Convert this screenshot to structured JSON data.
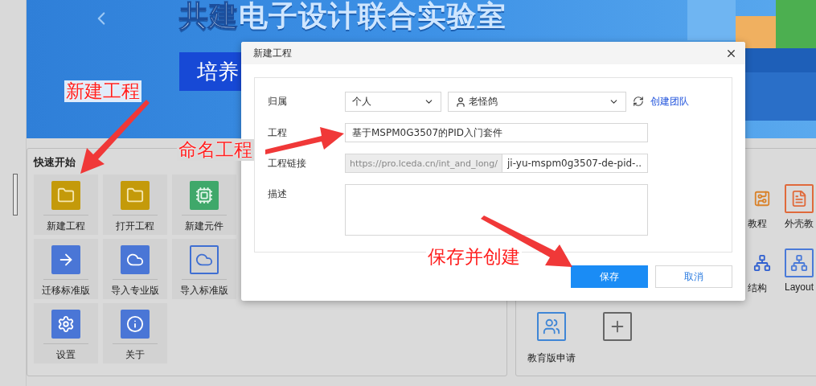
{
  "banner": {
    "title_highlight": "共建",
    "title_rest": "电子设计联合实验室",
    "subtitle": "培养"
  },
  "quick_start": {
    "title": "快速开始",
    "tiles": [
      {
        "label": "新建工程",
        "kind": "folder"
      },
      {
        "label": "打开工程",
        "kind": "folder"
      },
      {
        "label": "新建元件",
        "kind": "component"
      },
      {
        "label": "迁移标准版",
        "kind": "migrate"
      },
      {
        "label": "导入专业版",
        "kind": "cloud"
      },
      {
        "label": "导入标准版",
        "kind": "cloud_outline"
      },
      {
        "label": "设置",
        "kind": "settings"
      },
      {
        "label": "关于",
        "kind": "info"
      }
    ]
  },
  "right_panel": {
    "top_tiles": [
      {
        "label": "教程",
        "kind": "pcb"
      },
      {
        "label": "外壳教",
        "kind": "doc"
      },
      {
        "label": "结构",
        "kind": "plc"
      },
      {
        "label": "Layout",
        "kind": "layout"
      }
    ],
    "bottom_tiles": [
      {
        "label": "教育版申请",
        "kind": "edu"
      },
      {
        "kind": "add"
      }
    ]
  },
  "dialog": {
    "title": "新建工程",
    "fields": [
      {
        "label": "归属",
        "kind": "owner",
        "owner_type": "个人",
        "account": "老怪鸽",
        "link": "创建团队"
      },
      {
        "label": "工程",
        "kind": "text",
        "value": "基于MSPM0G3507的PID入门套件"
      },
      {
        "label": "工程链接",
        "kind": "url",
        "prefix": "https://pro.lceda.cn/int_and_long/",
        "value": "ji-yu-mspm0g3507-de-pid-..."
      },
      {
        "label": "描述",
        "kind": "textarea"
      }
    ],
    "buttons": [
      {
        "label": "保存",
        "kind": "primary"
      },
      {
        "label": "取消",
        "kind": "secondary"
      }
    ]
  },
  "annotations": [
    {
      "text": "新建工程"
    },
    {
      "text": "命名工程"
    },
    {
      "text": "保存并创建"
    }
  ]
}
